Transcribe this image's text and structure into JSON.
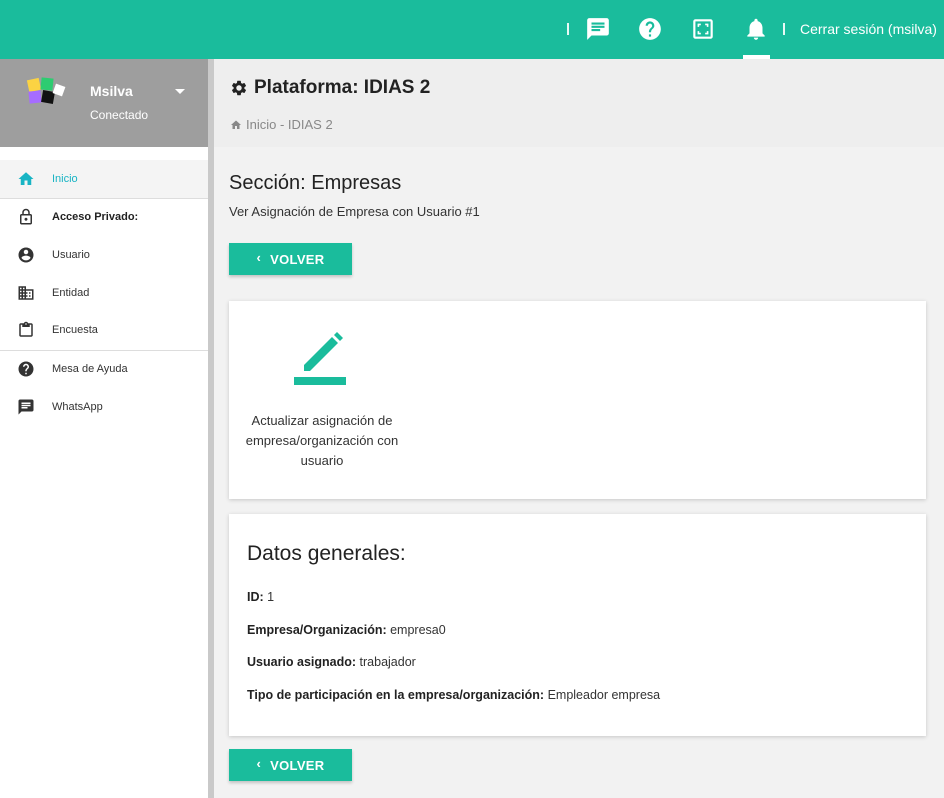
{
  "topbar": {
    "icons": [
      "chat-icon",
      "help-icon",
      "fullscreen-icon",
      "bell-icon"
    ],
    "logout_label": "Cerrar sesión (msilva)",
    "accent": "#1abc9c"
  },
  "sidebar": {
    "user": {
      "name": "Msilva",
      "status": "Conectado"
    },
    "items": [
      {
        "label": "Inicio",
        "icon": "home-icon",
        "active": true
      },
      {
        "label": "Acceso Privado:",
        "icon": "lock-icon",
        "header": true
      },
      {
        "label": "Usuario",
        "icon": "user-circle-icon"
      },
      {
        "label": "Entidad",
        "icon": "building-icon"
      },
      {
        "label": "Encuesta",
        "icon": "clipboard-icon"
      },
      {
        "label": "Mesa de Ayuda",
        "icon": "help-icon"
      },
      {
        "label": "WhatsApp",
        "icon": "message-icon"
      }
    ]
  },
  "header": {
    "title": "Plataforma: IDIAS 2",
    "breadcrumb": "Inicio - IDIAS 2"
  },
  "main": {
    "section_title": "Sección: Empresas",
    "section_subtitle": "Ver Asignación de Empresa con Usuario #1",
    "back_label": "VOLVER",
    "action_label": "Actualizar asignación de empresa/organización con usuario",
    "details": {
      "title": "Datos generales:",
      "fields": [
        {
          "label": "ID:",
          "value": "1"
        },
        {
          "label": "Empresa/Organización:",
          "value": "empresa0"
        },
        {
          "label": "Usuario asignado:",
          "value": "trabajador"
        },
        {
          "label": "Tipo de participación en la empresa/organización:",
          "value": "Empleador empresa"
        }
      ]
    }
  }
}
